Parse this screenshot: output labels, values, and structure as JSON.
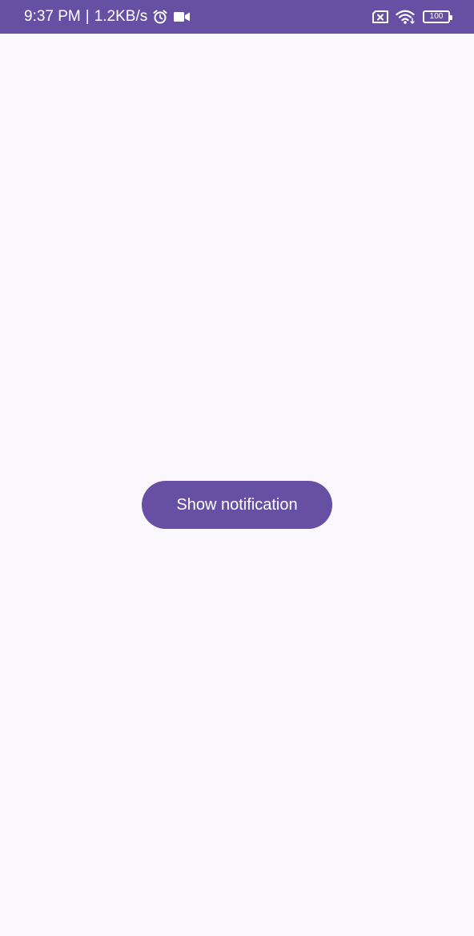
{
  "status_bar": {
    "time": "9:37 PM",
    "separator": "|",
    "net_speed": "1.2KB/s",
    "battery_level": "100",
    "icons": [
      "alarm-icon",
      "video-camera-icon",
      "sim-missing-icon",
      "wifi-icon",
      "battery-icon"
    ]
  },
  "main": {
    "button_label": "Show notification"
  },
  "colors": {
    "accent": "#6750a4",
    "background": "#fbf8fd",
    "on_accent": "#ffffff"
  }
}
